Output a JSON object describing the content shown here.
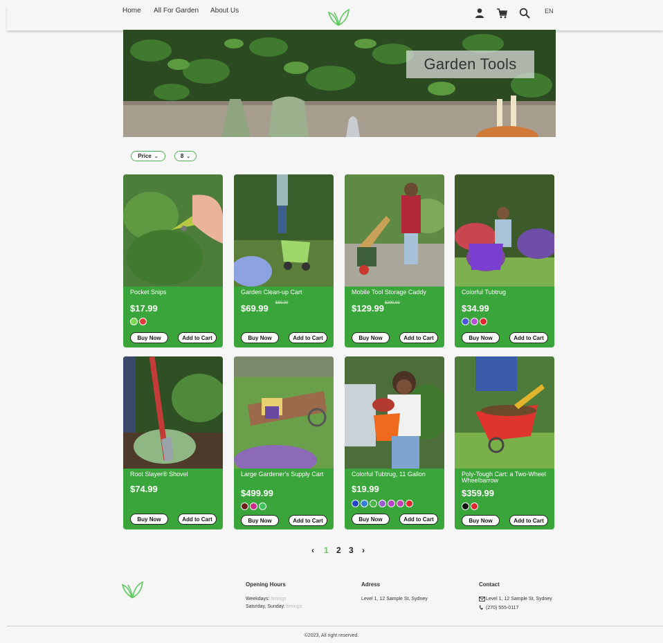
{
  "nav": {
    "home": "Home",
    "all_for_garden": "All For Garden",
    "about": "About Us",
    "lang": "EN"
  },
  "hero": {
    "title": "Garden Tools"
  },
  "filters": {
    "price": "Price",
    "per_page": "8"
  },
  "products": [
    {
      "name": "Pocket Snips",
      "price": "$17.99",
      "old_price": "",
      "swatches": [
        "#7cd64f",
        "#e23b3b"
      ]
    },
    {
      "name": "Garden Clean-up Cart",
      "price": "$69.99",
      "old_price": "$80.00",
      "swatches": []
    },
    {
      "name": "Mobile Tool Storage Caddy",
      "price": "$129.99",
      "old_price": "$200.00",
      "swatches": []
    },
    {
      "name": "Colorful Tubtrug",
      "price": "$34.99",
      "old_price": "",
      "swatches": [
        "#4a56d8",
        "#b54fd6",
        "#e0262f"
      ]
    },
    {
      "name": "Root Slayer® Shovel",
      "price": "$74.99",
      "old_price": "",
      "swatches": []
    },
    {
      "name": "Large Gardener's Supply Cart",
      "price": "$499.99",
      "old_price": "",
      "swatches": [
        "#6b1f1a",
        "#d02b8a",
        "#3ec25a"
      ]
    },
    {
      "name": "Colorful Tubtrug, 11 Gallon",
      "price": "$19.99",
      "old_price": "",
      "swatches": [
        "#1f47c9",
        "#2f7fd4",
        "#48b548",
        "#9b5fd4",
        "#b542c8",
        "#c33fb6",
        "#e0262f"
      ]
    },
    {
      "name": "Poly-Tough Cart: a Two-Wheel Wheelbarrow",
      "price": "$359.99",
      "old_price": "",
      "swatches": [
        "#111111",
        "#e0262f"
      ]
    }
  ],
  "buttons": {
    "buy": "Buy Now",
    "cart": "Add to Cart"
  },
  "pagination": {
    "prev": "‹",
    "pages": [
      "1",
      "2",
      "3"
    ],
    "next": "›",
    "active": "1"
  },
  "footer": {
    "hours_title": "Opening Hours",
    "weekdays_label": "Weekdays:",
    "weekdays_value": "timings",
    "weekend_label": "Saturday, Sunday:",
    "weekend_value": "timings",
    "address_title": "Adress",
    "address": "Level 1, 12 Sample St, Sydney",
    "contact_title": "Contact",
    "contact_address": "Level 1, 12 Sample St, Sydney",
    "phone": "(270) 555-0117",
    "copyright": "©2023, All right reserved."
  },
  "colors": {
    "card_green": "#3aa53a",
    "accent": "#4caf50"
  }
}
